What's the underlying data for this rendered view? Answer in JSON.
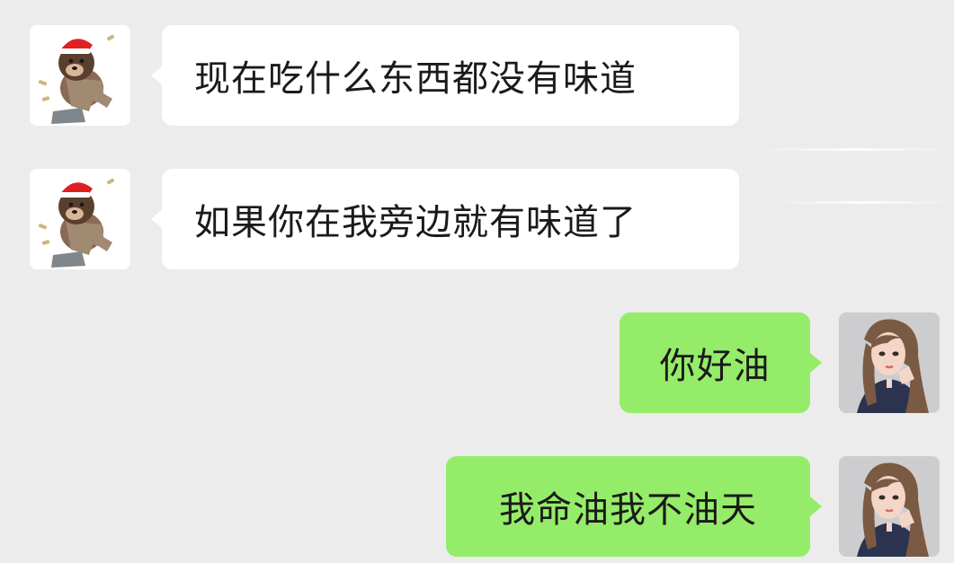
{
  "chat": {
    "messages": [
      {
        "sender": "other",
        "avatar_icon": "bear-santa-avatar-icon",
        "text": "现在吃什么东西都没有味道"
      },
      {
        "sender": "other",
        "avatar_icon": "bear-santa-avatar-icon",
        "text": "如果你在我旁边就有味道了"
      },
      {
        "sender": "self",
        "avatar_icon": "girl-portrait-avatar-icon",
        "text": "你好油"
      },
      {
        "sender": "self",
        "avatar_icon": "girl-portrait-avatar-icon",
        "text": "我命油我不油天"
      }
    ]
  },
  "colors": {
    "background": "#ececec",
    "incoming_bubble": "#ffffff",
    "outgoing_bubble": "#95ec69",
    "text": "#1a1a1a"
  }
}
